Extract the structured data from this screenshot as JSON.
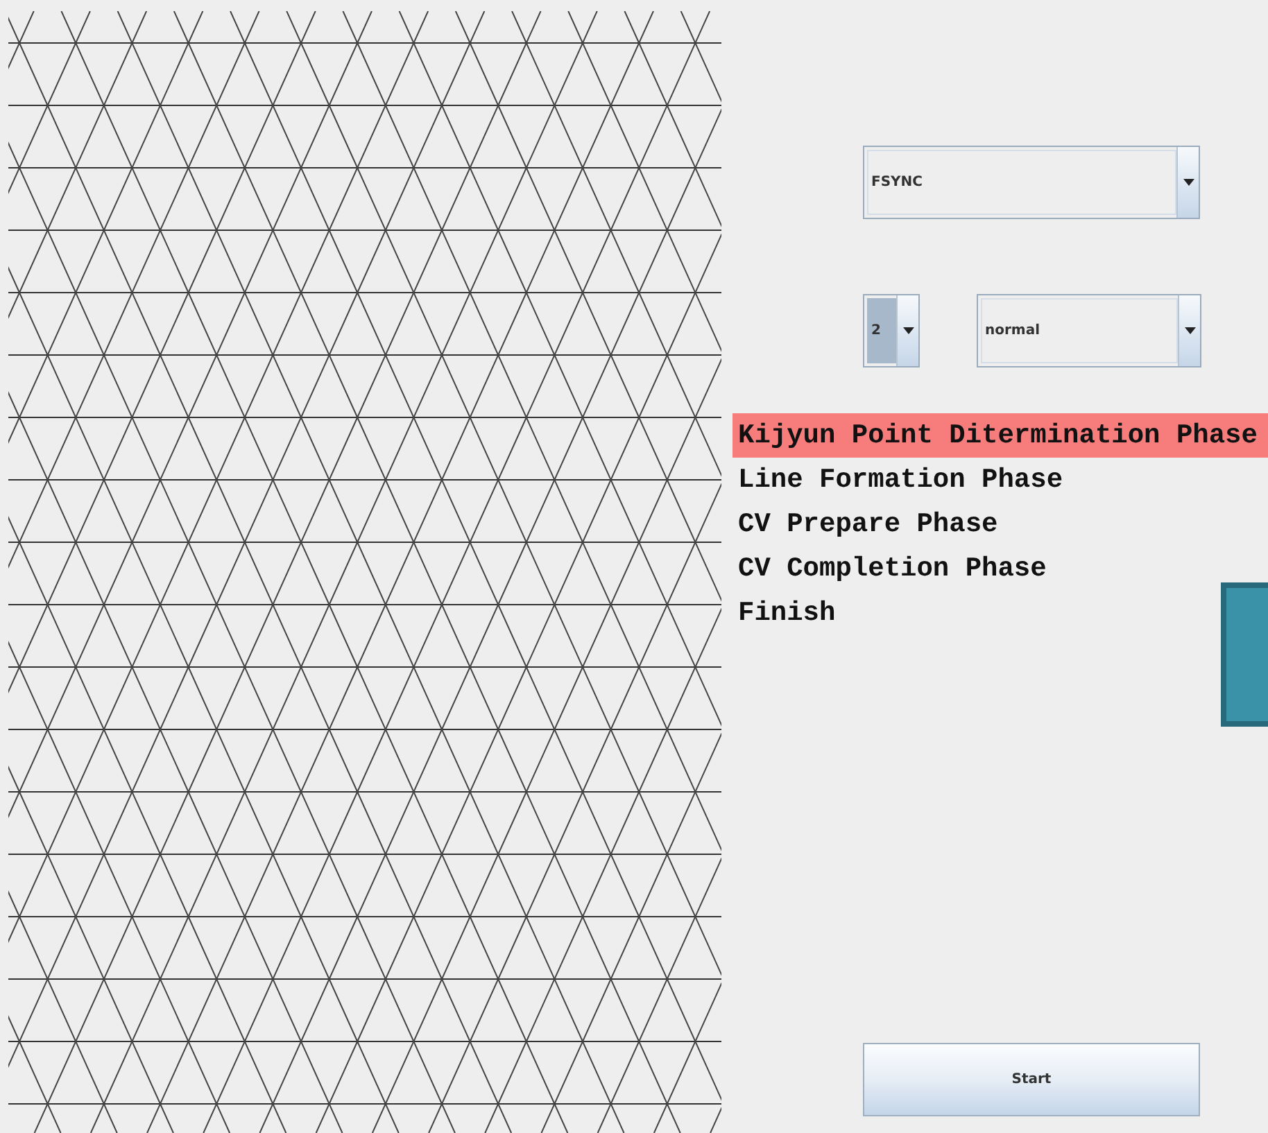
{
  "algorithm_select": {
    "value": "FSYNC"
  },
  "count_select": {
    "value": "2",
    "focused": true
  },
  "mode_select": {
    "value": "normal"
  },
  "phases": [
    {
      "label": "Kijyun Point Ditermination Phase",
      "selected": true
    },
    {
      "label": "Line Formation Phase",
      "selected": false
    },
    {
      "label": "CV Prepare Phase",
      "selected": false
    },
    {
      "label": "CV Completion Phase",
      "selected": false
    },
    {
      "label": "Finish",
      "selected": false
    }
  ],
  "start_button": {
    "label": "Start"
  }
}
